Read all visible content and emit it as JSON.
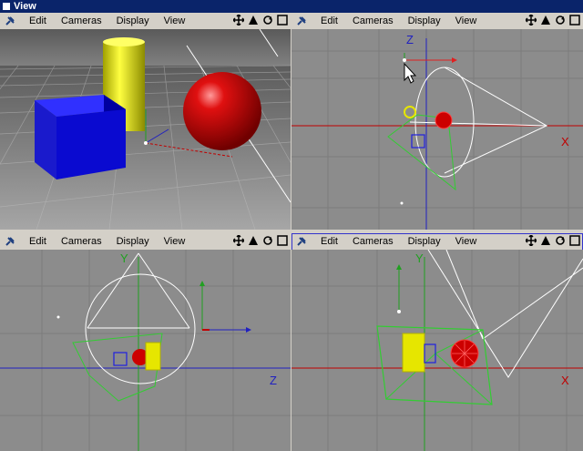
{
  "window": {
    "title": "View"
  },
  "menu": [
    "Edit",
    "Cameras",
    "Display",
    "View"
  ],
  "viewports": [
    {
      "id": "perspective",
      "axes": []
    },
    {
      "id": "top",
      "axes": [
        "Z",
        "X"
      ]
    },
    {
      "id": "front",
      "axes": [
        "Y",
        "Z"
      ]
    },
    {
      "id": "side",
      "axes": [
        "Y",
        "X"
      ]
    }
  ],
  "colors": {
    "titlebar": "#0a246a",
    "grid_bg": "#8c8c8c",
    "grid_line": "#7a7a7a",
    "axis_red": "#c00000",
    "axis_blue": "#2020c0",
    "axis_green": "#20a020",
    "camera_white": "#ffffff",
    "object_green": "#33cc33",
    "sphere_red": "#cc0000",
    "cube_blue": "#1010cc",
    "cylinder_yellow": "#e6e600"
  },
  "icons": [
    "pin-icon",
    "move-icon",
    "scale-icon",
    "rotate-icon",
    "maximize-icon"
  ]
}
